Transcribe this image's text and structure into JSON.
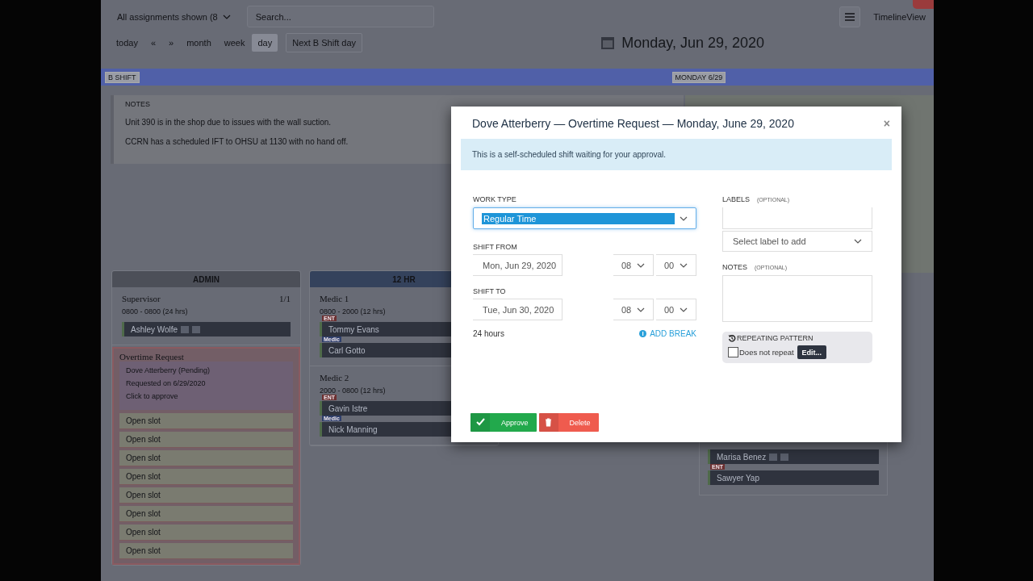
{
  "toolbar": {
    "filter": "All assignments shown (8",
    "search": {
      "placeholder": "Search..."
    },
    "view_button": "TimelineView"
  },
  "nav": {
    "buttons": [
      {
        "label": "today",
        "selected": false
      },
      {
        "label": "«",
        "selected": false
      },
      {
        "label": "»",
        "selected": false
      },
      {
        "label": "month",
        "selected": false
      },
      {
        "label": "week",
        "selected": false
      },
      {
        "label": "day",
        "selected": true
      }
    ],
    "next": "Next B Shift day",
    "date": "Monday, Jun 29, 2020"
  },
  "shift_bar": {
    "shift": "B SHIFT",
    "day": "MONDAY 6/29"
  },
  "notes": {
    "title": "NOTES",
    "lines": [
      "Unit 390 is in the shop due to issues with the wall suction.",
      "CCRN has a scheduled IFT to OHSU at 1130 with no hand off."
    ]
  },
  "columns": [
    {
      "title": "ADMIN",
      "color": "#4c4f58",
      "cards": [
        {
          "kind": "position",
          "title": "Supervisor",
          "count": "1/1",
          "hours": "0800 - 0800 (24 hrs)",
          "staff": [
            {
              "name": "Ashley Wolfe"
            }
          ]
        },
        {
          "kind": "request",
          "title": "Overtime Request",
          "lines": [
            "Dove Atterberry (Pending)",
            "Requested on 6/29/2020",
            "Click to approve"
          ],
          "slots": [
            "Open slot",
            "Open slot",
            "Open slot",
            "Open slot",
            "Open slot",
            "Open slot",
            "Open slot",
            "Open slot"
          ]
        }
      ]
    },
    {
      "title": "12 HR",
      "color": "#34425c",
      "cards": [
        {
          "kind": "position",
          "title": "Medic 1",
          "hours": "0800 - 2000 (12 hrs)",
          "staff": [
            {
              "role": "ENT",
              "color": "#6b2f30",
              "name": "Tommy Evans"
            },
            {
              "role": "Medic",
              "color": "#2f3f6b",
              "name": "Carl Gotto"
            }
          ]
        },
        {
          "kind": "position",
          "title": "Medic 2",
          "hours": "2000 - 0800 (12 hrs)",
          "staff": [
            {
              "role": "ENT",
              "color": "#6b2f30",
              "name": "Gavin Istre"
            },
            {
              "role": "Medic",
              "color": "#2f3f6b",
              "name": "Nick Manning"
            }
          ]
        }
      ]
    }
  ],
  "side_staff": [
    {
      "name": "Marisa Benez"
    },
    {
      "role": "ENT",
      "color": "#6b2f30",
      "name": "Sawyer Yap"
    }
  ],
  "modal": {
    "title": "Dove Atterberry — Overtime Request — Monday, June 29, 2020",
    "close": "×",
    "alert": "This is a self-scheduled shift waiting for your approval.",
    "work_type": {
      "label": "WORK TYPE",
      "value": "Regular Time"
    },
    "shift_from": {
      "label": "SHIFT FROM",
      "date": "Mon, Jun 29, 2020",
      "hour": "08",
      "minute": "00"
    },
    "shift_to": {
      "label": "SHIFT TO",
      "date": "Tue, Jun 30, 2020",
      "hour": "08",
      "minute": "00"
    },
    "duration": "24 hours",
    "add_break": "ADD BREAK",
    "labels": {
      "label": "LABELS",
      "hint": "(OPTIONAL)",
      "placeholder": "Select label to add"
    },
    "notes": {
      "label": "NOTES",
      "hint": "(OPTIONAL)"
    },
    "repeat": {
      "title": "REPEATING PATTERN",
      "option": "Does not repeat",
      "checked": false,
      "edit": "Edit..."
    },
    "buttons": [
      {
        "label": "Approve",
        "kind": "approve"
      },
      {
        "label": "Delete",
        "kind": "delete"
      }
    ]
  }
}
